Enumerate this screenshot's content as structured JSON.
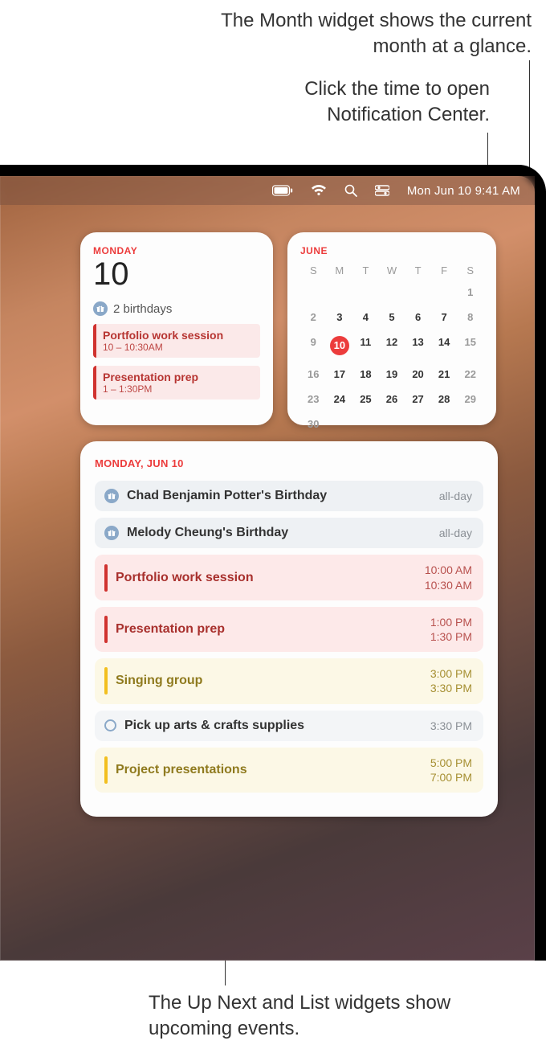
{
  "callouts": {
    "top1": "The Month widget shows the current month at a glance.",
    "top2": "Click the time to open Notification Center.",
    "bottom": "The Up Next and List widgets show upcoming events."
  },
  "menubar": {
    "clock": "Mon Jun 10  9:41 AM"
  },
  "upnext": {
    "dow": "MONDAY",
    "daynum": "10",
    "birthdays_label": "2 birthdays",
    "events": [
      {
        "title": "Portfolio work session",
        "sub": "10 – 10:30AM"
      },
      {
        "title": "Presentation prep",
        "sub": "1 – 1:30PM"
      }
    ]
  },
  "month": {
    "name": "JUNE",
    "dow": [
      "S",
      "M",
      "T",
      "W",
      "T",
      "F",
      "S"
    ],
    "weeks": [
      [
        "",
        "",
        "",
        "",
        "",
        "",
        "1"
      ],
      [
        "2",
        "3",
        "4",
        "5",
        "6",
        "7",
        "8"
      ],
      [
        "9",
        "10",
        "11",
        "12",
        "13",
        "14",
        "15"
      ],
      [
        "16",
        "17",
        "18",
        "19",
        "20",
        "21",
        "22"
      ],
      [
        "23",
        "24",
        "25",
        "26",
        "27",
        "28",
        "29"
      ],
      [
        "30",
        "",
        "",
        "",
        "",
        "",
        ""
      ]
    ],
    "today": "10"
  },
  "list": {
    "hdr": "MONDAY, JUN 10",
    "events": [
      {
        "kind": "bday",
        "title": "Chad Benjamin Potter's Birthday",
        "time": "all-day"
      },
      {
        "kind": "bday",
        "title": "Melody Cheung's Birthday",
        "time": "all-day"
      },
      {
        "kind": "red",
        "title": "Portfolio work session",
        "t1": "10:00 AM",
        "t2": "10:30 AM"
      },
      {
        "kind": "red",
        "title": "Presentation prep",
        "t1": "1:00 PM",
        "t2": "1:30 PM"
      },
      {
        "kind": "yellow",
        "title": "Singing group",
        "t1": "3:00 PM",
        "t2": "3:30 PM"
      },
      {
        "kind": "blue",
        "title": "Pick up arts & crafts supplies",
        "time": "3:30 PM"
      },
      {
        "kind": "yellow",
        "title": "Project presentations",
        "t1": "5:00 PM",
        "t2": "7:00 PM"
      }
    ]
  }
}
